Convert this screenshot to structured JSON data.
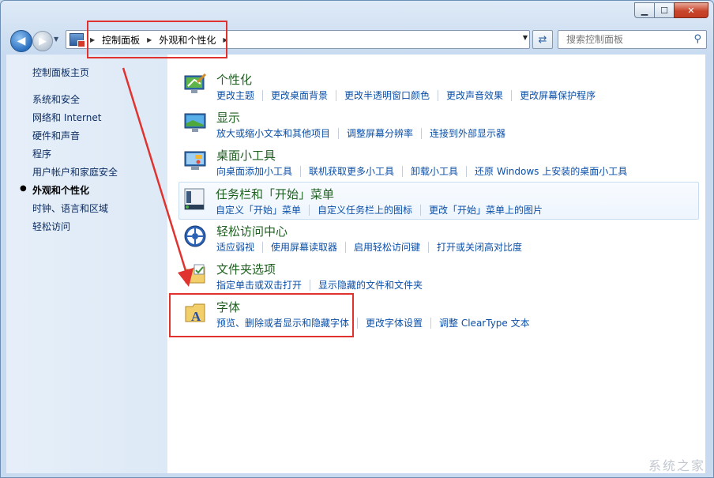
{
  "breadcrumb": [
    "控制面板",
    "外观和个性化"
  ],
  "search": {
    "placeholder": "搜索控制面板"
  },
  "sidebar": {
    "items": [
      {
        "label": "控制面板主页",
        "active": false
      },
      {
        "label": "系统和安全",
        "active": false
      },
      {
        "label": "网络和 Internet",
        "active": false
      },
      {
        "label": "硬件和声音",
        "active": false
      },
      {
        "label": "程序",
        "active": false
      },
      {
        "label": "用户帐户和家庭安全",
        "active": false
      },
      {
        "label": "外观和个性化",
        "active": true
      },
      {
        "label": "时钟、语言和区域",
        "active": false
      },
      {
        "label": "轻松访问",
        "active": false
      }
    ]
  },
  "sections": [
    {
      "title": "个性化",
      "icon": "personalization-icon",
      "links": [
        "更改主题",
        "更改桌面背景",
        "更改半透明窗口颜色",
        "更改声音效果",
        "更改屏幕保护程序"
      ]
    },
    {
      "title": "显示",
      "icon": "display-icon",
      "links": [
        "放大或缩小文本和其他项目",
        "调整屏幕分辨率",
        "连接到外部显示器"
      ]
    },
    {
      "title": "桌面小工具",
      "icon": "gadgets-icon",
      "links": [
        "向桌面添加小工具",
        "联机获取更多小工具",
        "卸载小工具",
        "还原 Windows 上安装的桌面小工具"
      ]
    },
    {
      "title": "任务栏和「开始」菜单",
      "icon": "taskbar-icon",
      "links": [
        "自定义「开始」菜单",
        "自定义任务栏上的图标",
        "更改「开始」菜单上的图片"
      ]
    },
    {
      "title": "轻松访问中心",
      "icon": "ease-of-access-icon",
      "links": [
        "适应弱视",
        "使用屏幕读取器",
        "启用轻松访问键",
        "打开或关闭高对比度"
      ]
    },
    {
      "title": "文件夹选项",
      "icon": "folder-options-icon",
      "links": [
        "指定单击或双击打开",
        "显示隐藏的文件和文件夹"
      ]
    },
    {
      "title": "字体",
      "icon": "fonts-icon",
      "links": [
        "预览、删除或者显示和隐藏字体",
        "更改字体设置",
        "调整 ClearType 文本"
      ]
    }
  ],
  "watermark": "系统之家",
  "colors": {
    "link": "#0b4fa8",
    "title": "#1e5f20",
    "annotation": "#e0322f"
  }
}
